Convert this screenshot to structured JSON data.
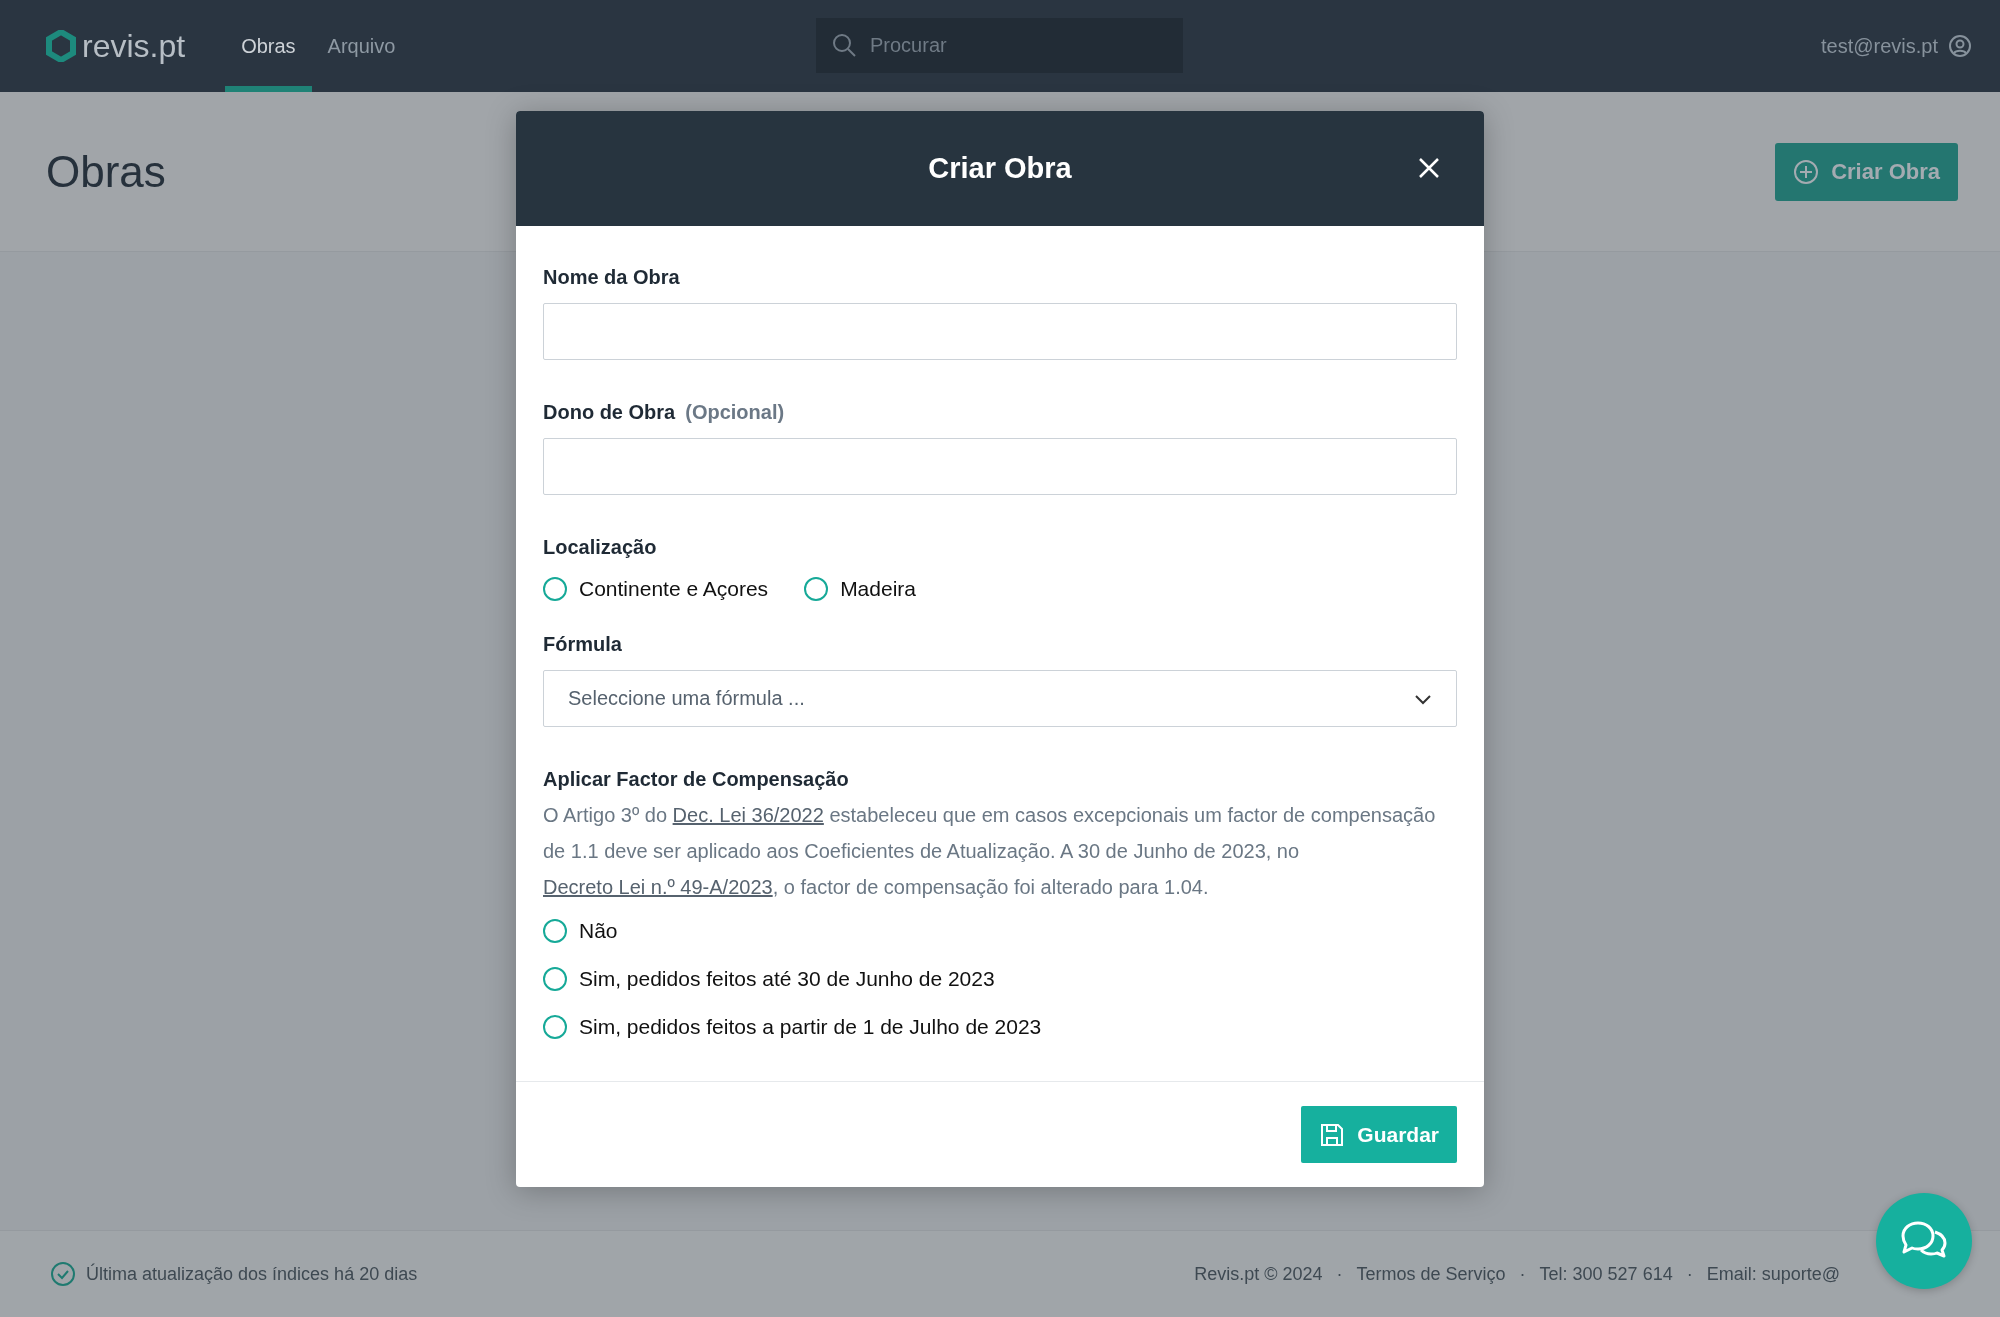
{
  "header": {
    "logo": "**revis**.pt",
    "tabs": [
      {
        "label": "Obras",
        "selected": true
      },
      {
        "label": "Arquivo",
        "selected": false
      }
    ],
    "search": {
      "placeholder": "Procurar"
    },
    "user": "test@revis.pt"
  },
  "page": {
    "title": "Obras",
    "create_button": "Criar Obra"
  },
  "modal": {
    "title": "Criar Obra",
    "fields": [
      {
        "kind": "text",
        "label": "Nome da Obra"
      },
      {
        "kind": "text",
        "label": "Dono de Obra",
        "hint": "(Opcional)"
      },
      {
        "kind": "radio",
        "label": "Localização",
        "inline": true,
        "options": [
          {
            "label": "Continente e Açores",
            "selected": false
          },
          {
            "label": "Madeira",
            "selected": false
          }
        ]
      },
      {
        "kind": "select",
        "label": "Fórmula",
        "placeholder": "Seleccione uma fórmula ..."
      },
      {
        "kind": "radio",
        "label": "Aplicar Factor de Compensação",
        "inline": false,
        "description": [
          {
            "text": "O Artigo 3º do ",
            "link": false
          },
          {
            "text": "Dec. Lei 36/2022",
            "link": true
          },
          {
            "text": " estabeleceu que em casos excepcionais um factor de compensação de 1.1 deve ser aplicado aos Coeficientes de Atualização. A 30 de Junho de 2023, no ",
            "link": false
          },
          {
            "text": "Decreto Lei n.º 49-A/2023",
            "link": true
          },
          {
            "text": ", o factor de compensação foi alterado para 1.04.",
            "link": false
          }
        ],
        "options": [
          {
            "label": "Não",
            "selected": false
          },
          {
            "label": "Sim, pedidos feitos até 30 de Junho de 2023",
            "selected": false
          },
          {
            "label": "Sim, pedidos feitos a partir de 1 de Julho de 2023",
            "selected": false
          }
        ]
      }
    ],
    "save_button": "Guardar"
  },
  "footer": {
    "status": "Última atualização dos índices há 20 dias",
    "separator": "·",
    "links": [
      "Revis.pt © 2024",
      "Termos de Serviço",
      "Tel: 300 527 614",
      "Email: suporte@"
    ]
  }
}
